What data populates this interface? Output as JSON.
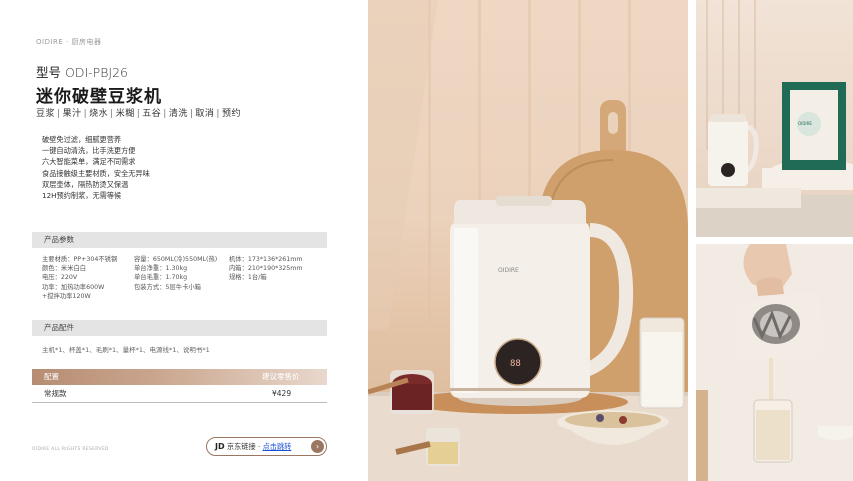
{
  "brand_line": "OIDIRE · 厨房电器",
  "model_label": "型号",
  "model_code": "ODI-PBJ26",
  "product_title": "迷你破壁豆浆机",
  "functions": [
    "豆浆",
    "果汁",
    "烧水",
    "米糊",
    "五谷",
    "清洗",
    "取消",
    "预约"
  ],
  "features": [
    "破壁免过滤，细腻更营养",
    "一键自动清洗，比手洗更方便",
    "六大智能菜单，满足不同需求",
    "食品接触级主要材质，安全无异味",
    "双层壶体，隔热防烫又保温",
    "12H预约制浆，无需等候"
  ],
  "params_header": "产品参数",
  "params": {
    "col1": [
      "主要材质：PP+304不锈钢",
      "颜色：米米白白",
      "电压：220V",
      "功率：加热功率600W",
      "+搅拌功率120W"
    ],
    "col2": [
      "容量：650ML(冷)550ML(热)",
      "单台净重：1.30kg",
      "单台毛重：1.70kg",
      "包装方式：5层牛卡小箱"
    ],
    "col3": [
      "机体：173*136*261mm",
      "内箱：210*190*325mm",
      "规格：1台/箱"
    ]
  },
  "accessories_header": "产品配件",
  "accessories": "主机*1、杯盖*1、毛刷*1、量杯*1、电源线*1、说明书*1",
  "price_table": {
    "header_left": "配置",
    "header_right": "建议零售价",
    "row_left": "常规款",
    "row_right": "¥429"
  },
  "copyright": "OIDIRE ALL RIGHTS RESERVED",
  "jd": {
    "logo": "JD",
    "text": "京东链接",
    "link": "点击跳转",
    "arrow": "›"
  },
  "product_display": {
    "brand_on_machine": "OIDIRE",
    "display_readout": "88",
    "box_label": "OIDIRE"
  },
  "colors": {
    "price_bar": "#b68d73",
    "accent_border": "#9a7663",
    "link": "#1a4fd6",
    "section_bar": "#e4e4e4"
  }
}
